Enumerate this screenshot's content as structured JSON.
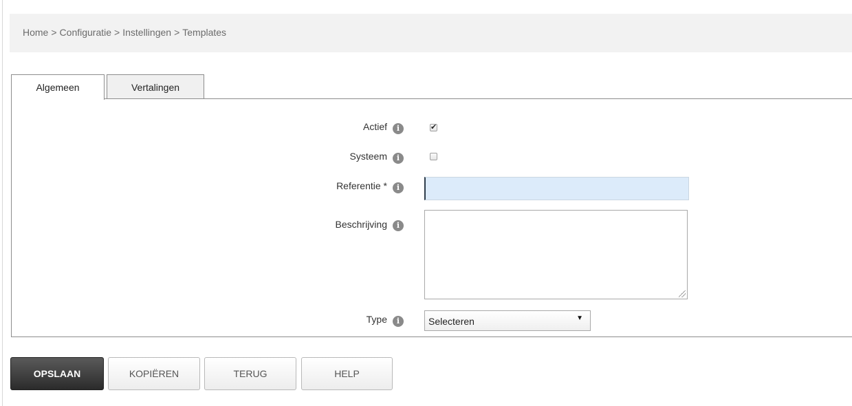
{
  "breadcrumb": {
    "items": [
      "Home",
      "Configuratie",
      "Instellingen",
      "Templates"
    ],
    "separator": ">"
  },
  "tabs": [
    {
      "label": "Algemeen",
      "active": true
    },
    {
      "label": "Vertalingen",
      "active": false
    }
  ],
  "form": {
    "active": {
      "label": "Actief",
      "checked": true
    },
    "system": {
      "label": "Systeem",
      "checked": false
    },
    "reference": {
      "label": "Referentie *",
      "value": ""
    },
    "description": {
      "label": "Beschrijving",
      "value": ""
    },
    "type": {
      "label": "Type",
      "selected": "Selecteren"
    }
  },
  "info_icon_glyph": "i",
  "check_glyph": "✔",
  "select_arrow_glyph": "▼",
  "actions": {
    "save": "OPSLAAN",
    "copy": "KOPIËREN",
    "back": "TERUG",
    "help": "HELP"
  },
  "colors": {
    "save_button_bg": "#333333",
    "input_focus_bg": "#dcebfa",
    "breadcrumb_bar_bg": "#f2f2f2",
    "info_icon_bg": "#8a8a8a"
  }
}
